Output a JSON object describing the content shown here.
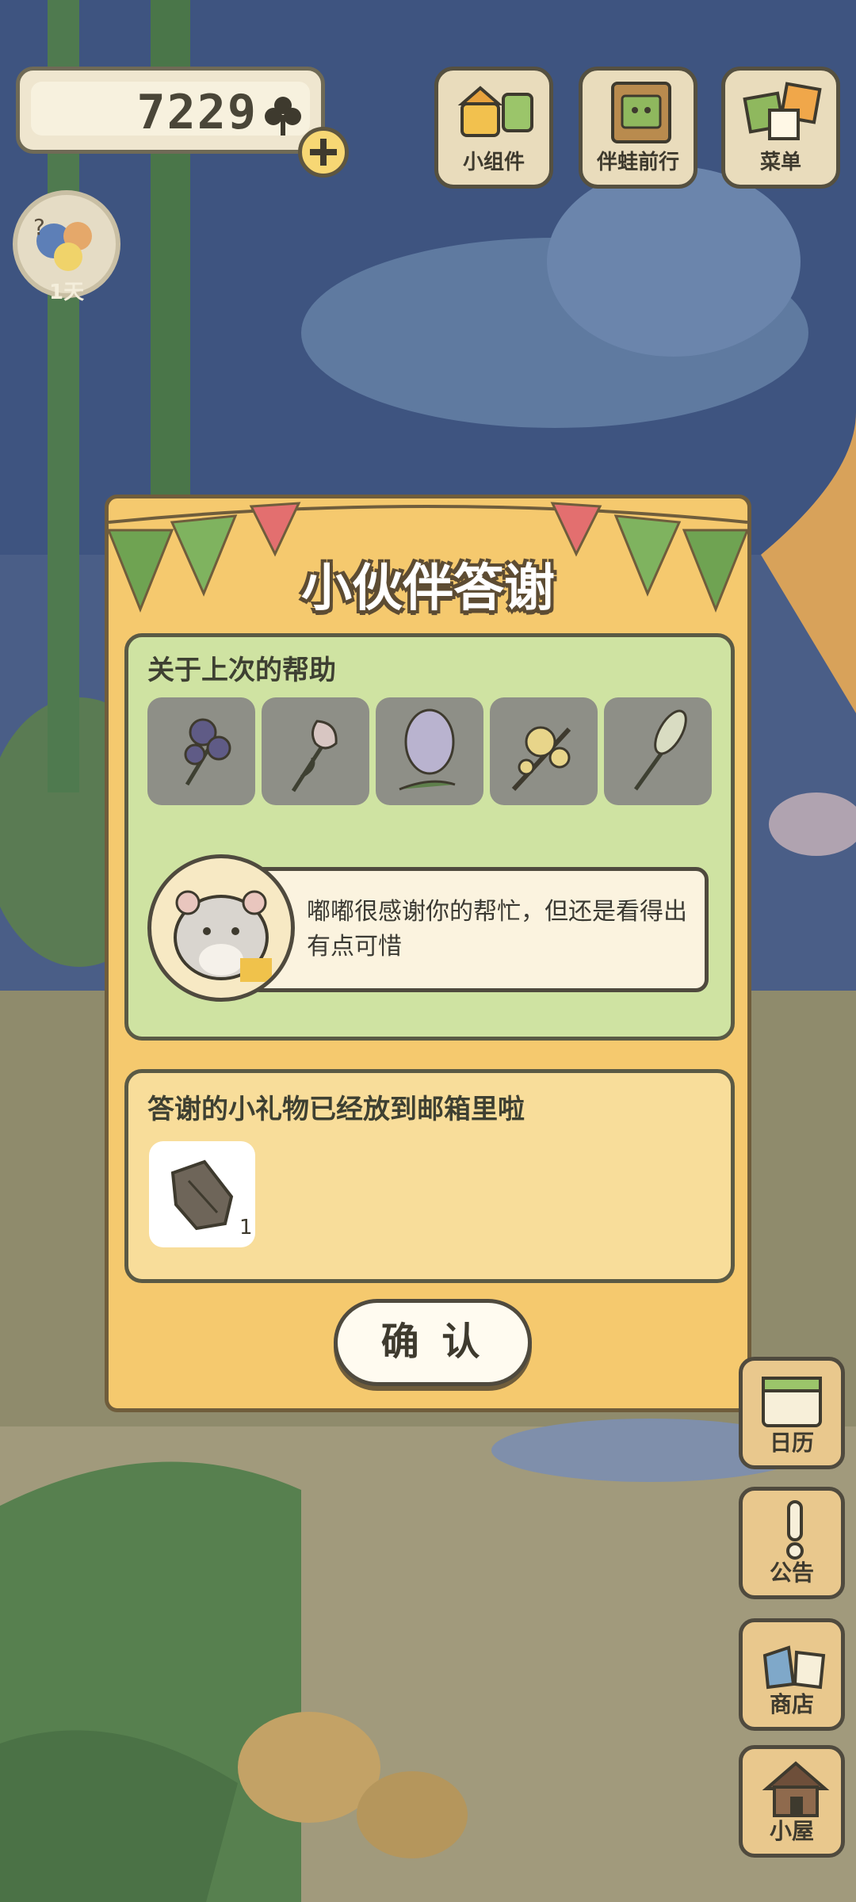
{
  "currency": {
    "amount": "7229",
    "icon": "clover-icon"
  },
  "top_buttons": [
    {
      "label": "小组件",
      "icon": "widget-icon"
    },
    {
      "label": "伴蛙前行",
      "icon": "journey-book-icon"
    },
    {
      "label": "菜单",
      "icon": "menu-cards-icon"
    }
  ],
  "visitor_badge": {
    "label": "1天"
  },
  "dialog": {
    "title": "小伙伴答谢",
    "help_section": {
      "title": "关于上次的帮助",
      "flowers": [
        "pansy",
        "tulip",
        "lilac",
        "camellia",
        "hyacinth"
      ]
    },
    "message": "嘟嘟很感谢你的帮忙，但还是看得出有点可惜",
    "gift_section": {
      "title": "答谢的小礼物已经放到邮箱里啦",
      "item": "wood-bark",
      "quantity": "1"
    },
    "confirm_label": "确 认"
  },
  "side_buttons": [
    {
      "label": "日历",
      "icon": "calendar-icon"
    },
    {
      "label": "公告",
      "icon": "notice-icon"
    },
    {
      "label": "商店",
      "icon": "shop-bags-icon"
    },
    {
      "label": "小屋",
      "icon": "house-icon"
    }
  ]
}
